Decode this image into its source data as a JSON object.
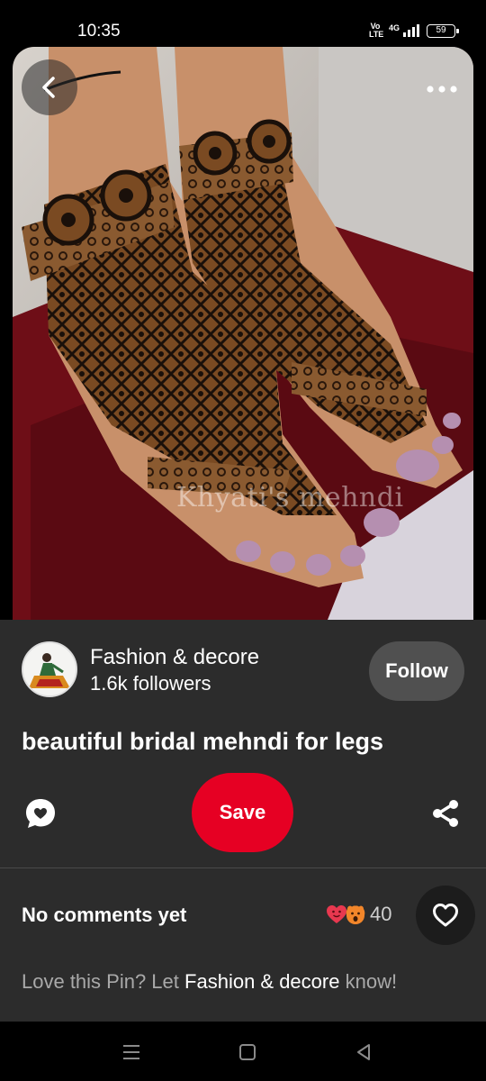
{
  "status_bar": {
    "time": "10:35",
    "volte_top": "Vo",
    "volte_bottom": "LTE",
    "network": "4G",
    "battery": "59"
  },
  "pin": {
    "watermark": "Khyati's mehndi",
    "title": "beautiful bridal mehndi for legs"
  },
  "creator": {
    "name": "Fashion & decore",
    "followers": "1.6k followers",
    "follow_label": "Follow"
  },
  "actions": {
    "save_label": "Save",
    "comment_icon": "comment-icon",
    "share_icon": "share-icon"
  },
  "comments": {
    "heading": "No comments yet",
    "reaction_count": "40",
    "prompt_before": "Love this Pin? Let",
    "prompt_name": "Fashion & decore",
    "prompt_after": "know!"
  },
  "colors": {
    "accent": "#e60023",
    "panel": "#2c2c2c",
    "follow_button": "#505050"
  }
}
